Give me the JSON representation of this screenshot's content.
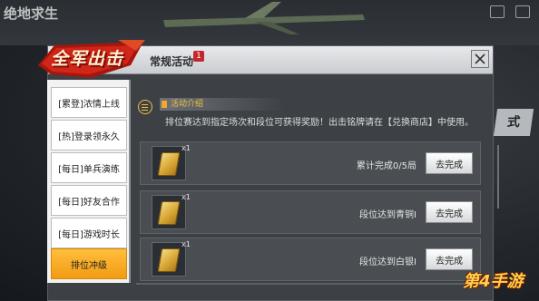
{
  "background": {
    "title": "绝地求生"
  },
  "logo": {
    "text": "全军出击"
  },
  "panel": {
    "title": "常规活动",
    "badge": "1"
  },
  "sidebar": {
    "items": [
      {
        "label": "[累登]浓情上线",
        "active": false
      },
      {
        "label": "[热]登录领永久",
        "active": false
      },
      {
        "label": "[每日]单兵演练",
        "active": false
      },
      {
        "label": "[每日]好友合作",
        "active": false
      },
      {
        "label": "[每日]游戏时长",
        "active": false
      },
      {
        "label": "排位冲级",
        "active": true
      }
    ]
  },
  "intro": {
    "tab_label": "活动介绍",
    "description": "排位赛达到指定场次和段位可获得奖励！出击铭牌请在【兑换商店】中使用。"
  },
  "rewards": [
    {
      "qty": "x1",
      "status": "累计完成0/5局",
      "button": "去完成"
    },
    {
      "qty": "x1",
      "status": "段位达到青铜I",
      "button": "去完成"
    },
    {
      "qty": "x1",
      "status": "段位达到白银I",
      "button": "去完成"
    }
  ],
  "side_tag": {
    "text": "式"
  },
  "watermark": {
    "text": "第4手游"
  },
  "colors": {
    "accent": "#f29b13",
    "badge": "#c4262d",
    "gold": "#f0c040"
  }
}
